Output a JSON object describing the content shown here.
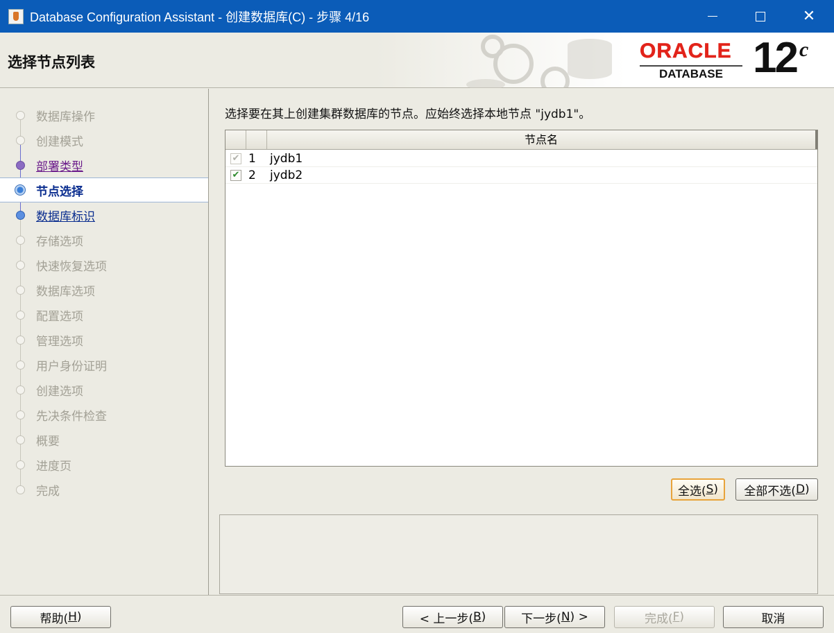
{
  "window": {
    "title": "Database Configuration Assistant - 创建数据库(C) - 步骤 4/16",
    "minimize_icon": "minimize-icon",
    "maximize_icon": "maximize-icon",
    "close_glyph": "✕"
  },
  "header": {
    "page_title": "选择节点列表",
    "logo_word": "ORACLE",
    "logo_sub": "DATABASE",
    "version_number": "12",
    "version_letter": "c"
  },
  "steps": [
    {
      "label": "数据库操作",
      "state": "disabled"
    },
    {
      "label": "创建模式",
      "state": "disabled"
    },
    {
      "label": "部署类型",
      "state": "visited"
    },
    {
      "label": "节点选择",
      "state": "current"
    },
    {
      "label": "数据库标识",
      "state": "next"
    },
    {
      "label": "存储选项",
      "state": "disabled"
    },
    {
      "label": "快速恢复选项",
      "state": "disabled"
    },
    {
      "label": "数据库选项",
      "state": "disabled"
    },
    {
      "label": "配置选项",
      "state": "disabled"
    },
    {
      "label": "管理选项",
      "state": "disabled"
    },
    {
      "label": "用户身份证明",
      "state": "disabled"
    },
    {
      "label": "创建选项",
      "state": "disabled"
    },
    {
      "label": "先决条件检查",
      "state": "disabled"
    },
    {
      "label": "概要",
      "state": "disabled"
    },
    {
      "label": "进度页",
      "state": "disabled"
    },
    {
      "label": "完成",
      "state": "disabled"
    }
  ],
  "main": {
    "instruction": "选择要在其上创建集群数据库的节点。应始终选择本地节点 \"jydb1\"。",
    "table": {
      "column_header": "节点名",
      "rows": [
        {
          "num": "1",
          "name": "jydb1",
          "checked": true,
          "disabled": true
        },
        {
          "num": "2",
          "name": "jydb2",
          "checked": true,
          "disabled": false
        }
      ]
    },
    "select_all": {
      "text": "全选(",
      "key": "S",
      "end": ")"
    },
    "deselect_all": {
      "text": "全部不选(",
      "key": "D",
      "end": ")"
    }
  },
  "footer": {
    "help": {
      "text": "帮助(",
      "key": "H",
      "end": ")"
    },
    "back": {
      "text": "< 上一步(",
      "key": "B",
      "end": ")"
    },
    "next": {
      "text": "下一步(",
      "key": "N",
      "end": ") >"
    },
    "finish": {
      "text": "完成(",
      "key": "F",
      "end": ")"
    },
    "cancel": {
      "text": "取消"
    }
  },
  "colors": {
    "titlebar": "#0b5cb8",
    "oracle_red": "#e2231a",
    "current_step": "#0a2d8f",
    "visited_step": "#6a1a8a",
    "checkmark": "#2e8b2e"
  }
}
